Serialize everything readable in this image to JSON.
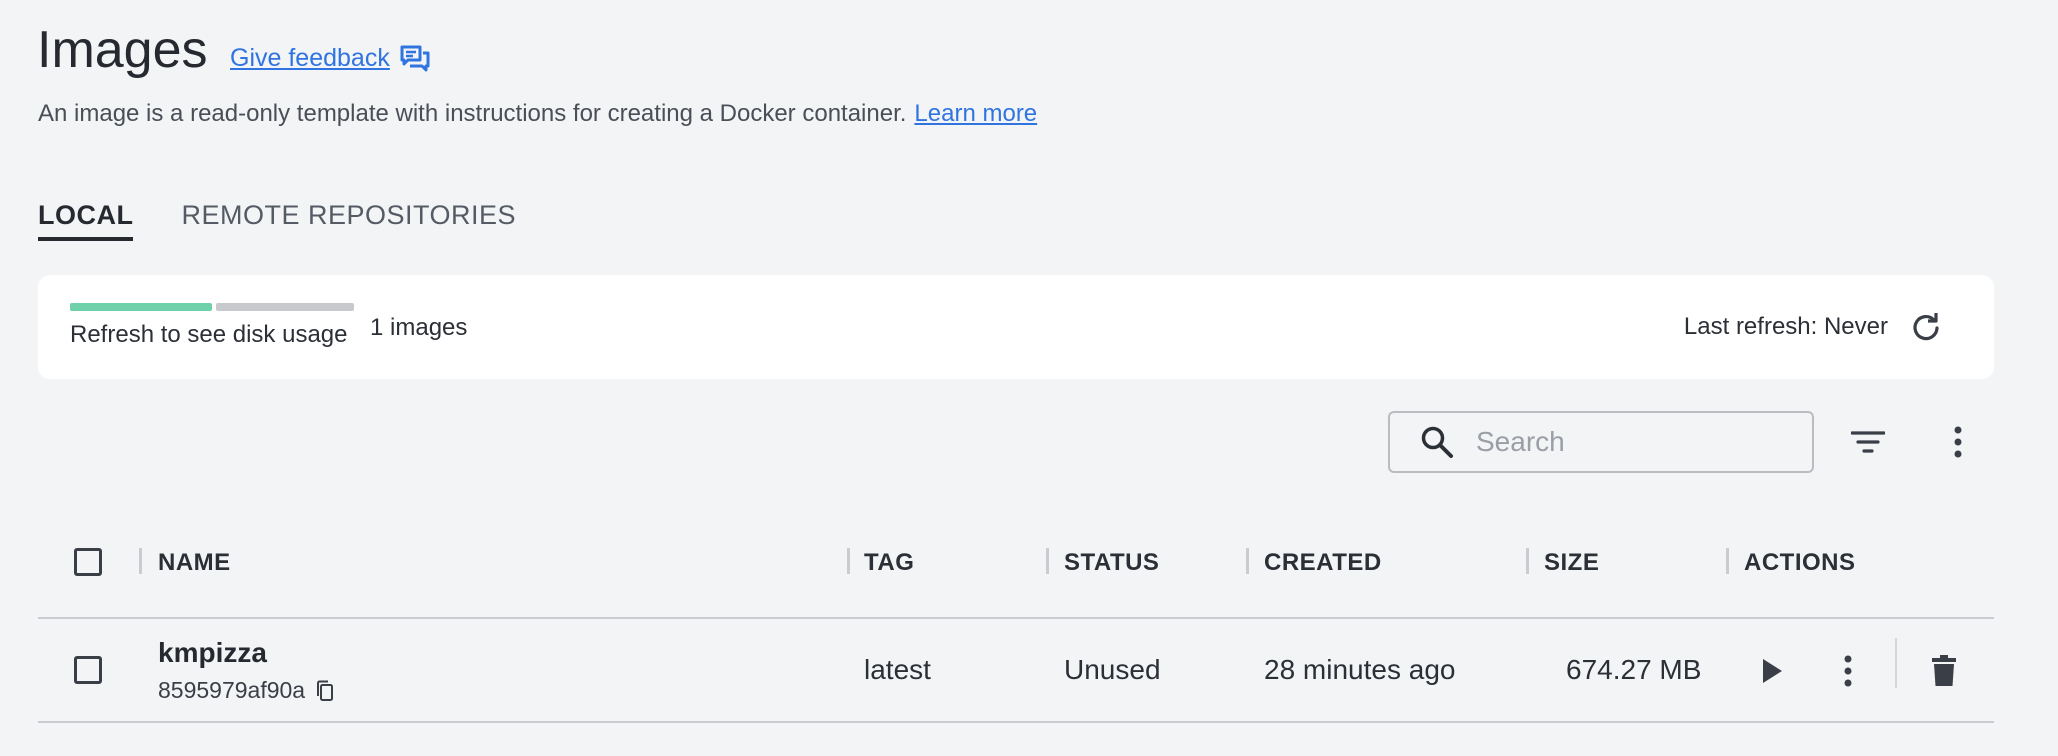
{
  "header": {
    "title": "Images",
    "feedback_label": "Give feedback",
    "feedback_icon": "feedback-chat-icon",
    "subtitle": "An image is a read-only template with instructions for creating a Docker container.",
    "learn_more": "Learn more"
  },
  "tabs": [
    {
      "label": "LOCAL",
      "active": true
    },
    {
      "label": "REMOTE REPOSITORIES",
      "active": false
    }
  ],
  "disk": {
    "label": "Refresh to see disk usage",
    "usage_fraction": 0.5,
    "count_text": "1 images",
    "last_refresh": "Last refresh: Never",
    "refresh_icon": "refresh-icon"
  },
  "toolbar": {
    "search_placeholder": "Search",
    "search_value": "",
    "filter_icon": "filter-icon",
    "more_icon": "kebab-menu-icon"
  },
  "table": {
    "columns": [
      "NAME",
      "TAG",
      "STATUS",
      "CREATED",
      "SIZE",
      "ACTIONS"
    ],
    "rows": [
      {
        "name": "kmpizza",
        "id": "8595979af90a",
        "tag": "latest",
        "status": "Unused",
        "created": "28 minutes ago",
        "size": "674.27 MB"
      }
    ]
  },
  "colors": {
    "accent": "#2f74e0",
    "disk_bar": "#6fd1a9",
    "background": "#f3f4f6",
    "card": "#ffffff"
  }
}
